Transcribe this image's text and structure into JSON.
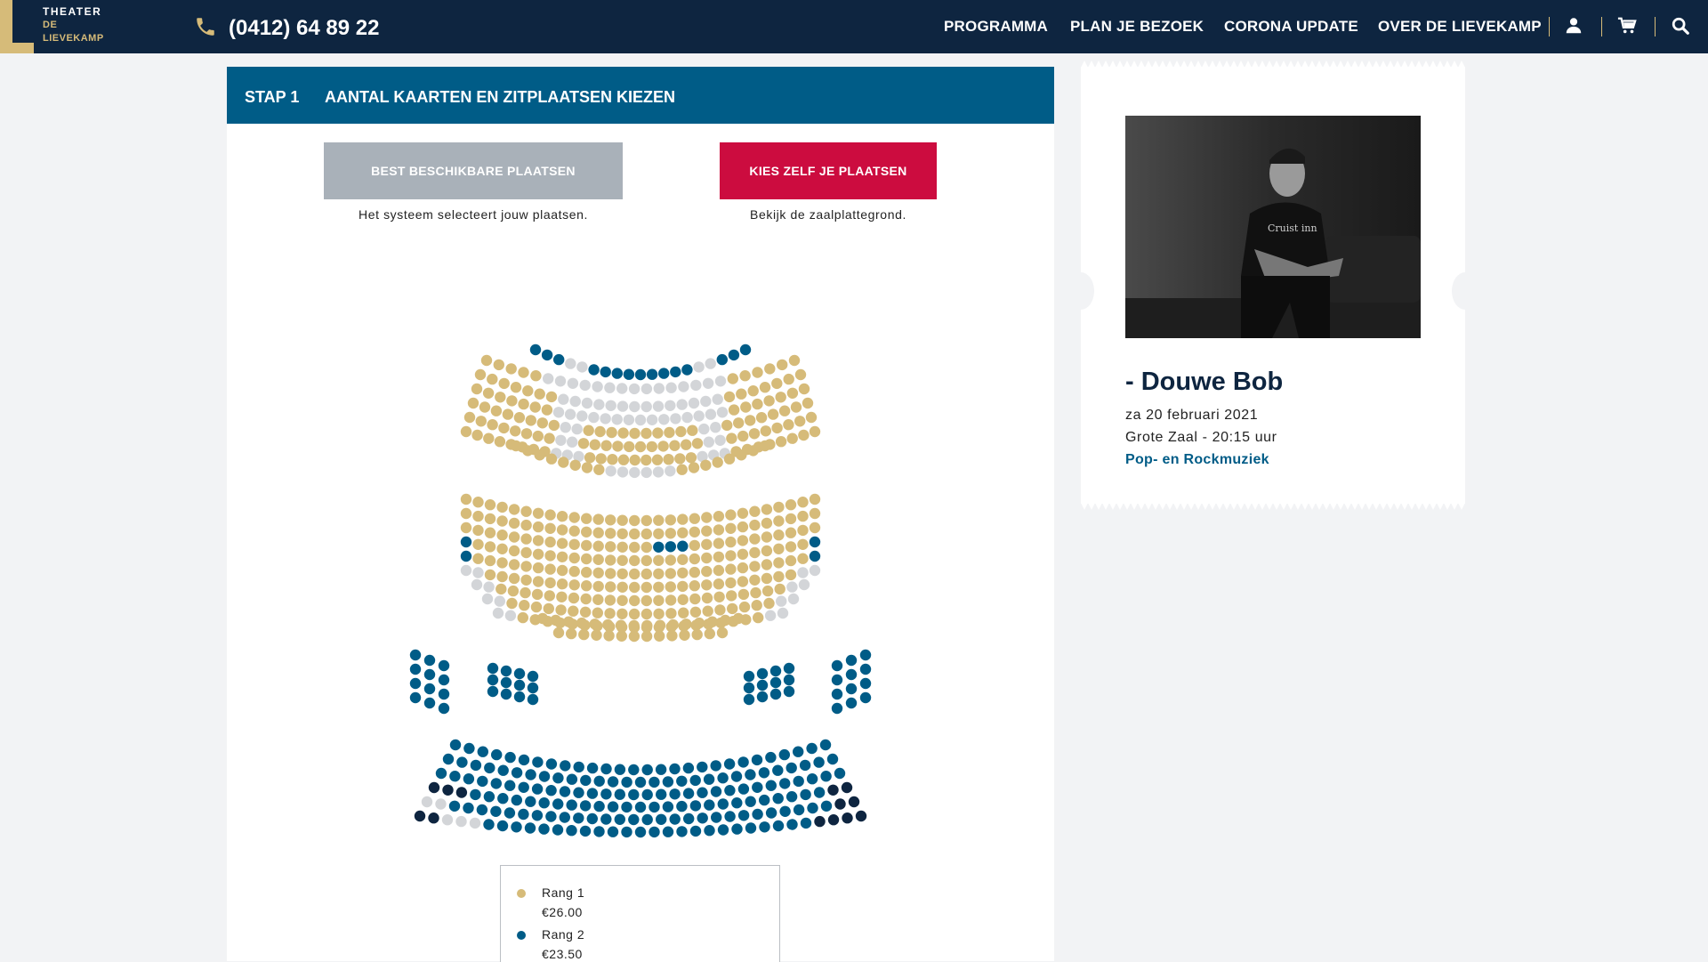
{
  "header": {
    "logo": {
      "line1": "THEATER",
      "line2": "DE",
      "line3": "LIEVEKAMP"
    },
    "phone": "(0412) 64 89 22",
    "nav": [
      "PROGRAMMA",
      "PLAN JE BEZOEK",
      "CORONA UPDATE",
      "OVER DE LIEVEKAMP"
    ],
    "icons": [
      "user-icon",
      "cart-icon",
      "search-icon"
    ]
  },
  "step": {
    "label": "STAP 1",
    "title": "AANTAL KAARTEN EN ZITPLAATSEN KIEZEN"
  },
  "options": {
    "best": {
      "label": "BEST BESCHIKBARE PLAATSEN",
      "sub": "Het systeem selecteert jouw plaatsen."
    },
    "kies": {
      "label": "KIES ZELF JE PLAATSEN",
      "sub": "Bekijk de zaalplattegrond."
    }
  },
  "legend": [
    {
      "label": "Rang 1",
      "price": "€26.00",
      "color": "#d6bb79"
    },
    {
      "label": "Rang 2",
      "price": "€23.50",
      "color": "#005c87"
    }
  ],
  "seat_colors": {
    "rang1": "#d6bb79",
    "rang2": "#005c87",
    "unavailable": "#d3d5d8",
    "selected": "#0e2540"
  },
  "event": {
    "name": "- Douwe Bob",
    "date": "za 20 februari 2021",
    "hall": "Grote Zaal - 20:15 uur",
    "genre": "Pop- en Rockmuziek"
  },
  "colors": {
    "navy": "#0e2540",
    "gold": "#d6bb79",
    "blue": "#005c87",
    "red": "#cc0c3f",
    "grey": "#a9b1b9"
  }
}
